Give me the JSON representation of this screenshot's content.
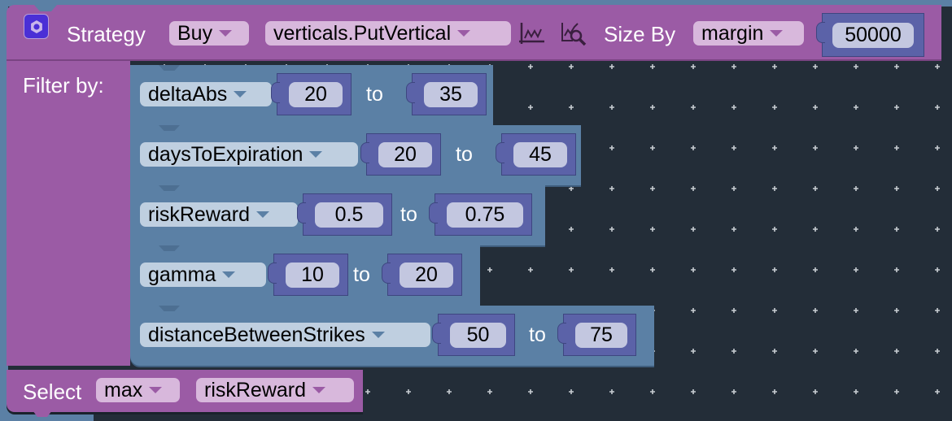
{
  "strategy": {
    "label": "Strategy",
    "action": "Buy",
    "strategy_type": "verticals.PutVertical",
    "chart_icon": "line-chart-icon",
    "analyze_icon": "chart-search-icon",
    "size_by_label": "Size By",
    "size_by": "margin",
    "size_value": "50000",
    "gear_icon": "gear-icon"
  },
  "filter": {
    "label": "Filter by:",
    "to_label": "to",
    "rows": [
      {
        "field": "deltaAbs",
        "min": "20",
        "max": "35"
      },
      {
        "field": "daysToExpiration",
        "min": "20",
        "max": "45"
      },
      {
        "field": "riskReward",
        "min": "0.5",
        "max": "0.75"
      },
      {
        "field": "gamma",
        "min": "10",
        "max": "20"
      },
      {
        "field": "distanceBetweenStrikes",
        "min": "50",
        "max": "75"
      }
    ]
  },
  "select": {
    "label": "Select",
    "mode": "max",
    "field": "riskReward"
  },
  "colors": {
    "workspace": "#232d38",
    "strategy_block": "#9b5ba5",
    "filter_block": "#5b80a5",
    "number_block": "#5b62a8"
  }
}
